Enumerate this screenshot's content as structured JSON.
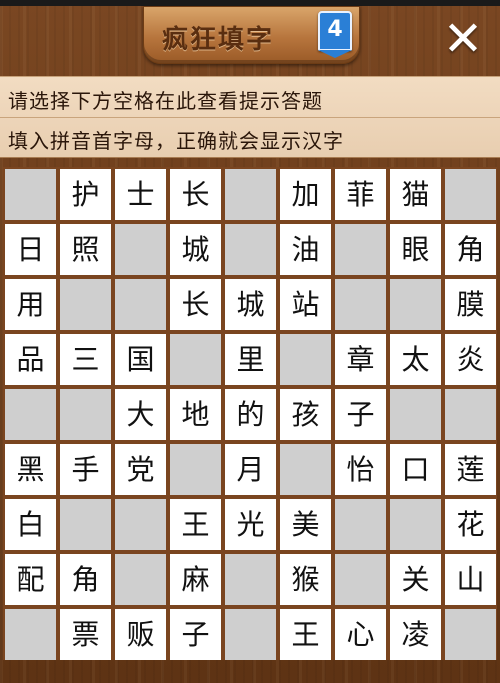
{
  "header": {
    "title": "疯狂填字",
    "level": "4",
    "close_label": "✕"
  },
  "hints": {
    "line1": "请选择下方空格在此查看提示答题",
    "line2": "填入拼音首字母，正确就会显示汉字"
  },
  "grid": {
    "rows": 9,
    "cols": 9,
    "cells": [
      [
        "",
        "护",
        "士",
        "长",
        "",
        "加",
        "菲",
        "猫",
        ""
      ],
      [
        "日",
        "照",
        "",
        "城",
        "",
        "油",
        "",
        "眼",
        "角"
      ],
      [
        "用",
        "",
        "",
        "长",
        "城",
        "站",
        "",
        "",
        "膜"
      ],
      [
        "品",
        "三",
        "国",
        "",
        "里",
        "",
        "章",
        "太",
        "炎"
      ],
      [
        "",
        "",
        "大",
        "地",
        "的",
        "孩",
        "子",
        "",
        ""
      ],
      [
        "黑",
        "手",
        "党",
        "",
        "月",
        "",
        "怡",
        "口",
        "莲"
      ],
      [
        "白",
        "",
        "",
        "王",
        "光",
        "美",
        "",
        "",
        "花"
      ],
      [
        "配",
        "角",
        "",
        "麻",
        "",
        "猴",
        "",
        "关",
        "山"
      ],
      [
        "",
        "票",
        "贩",
        "子",
        "",
        "王",
        "心",
        "凌",
        ""
      ]
    ]
  },
  "colors": {
    "wood": "#6b3e1c",
    "cell_filled": "#ffffff",
    "cell_empty": "#cfcfcf",
    "badge": "#2a7fd6"
  }
}
